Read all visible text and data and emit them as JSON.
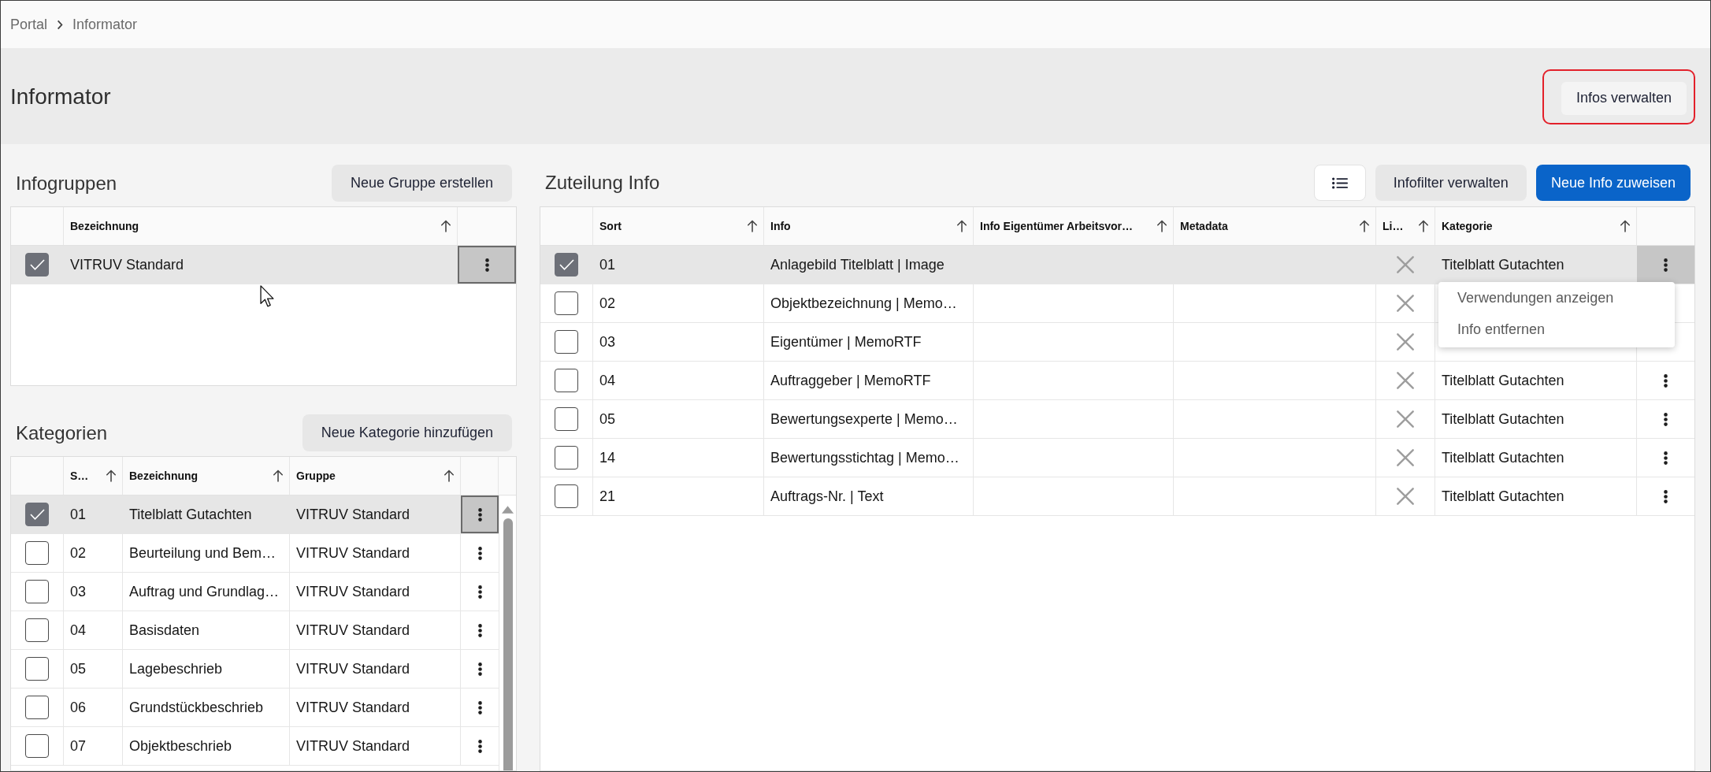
{
  "breadcrumb": [
    "Portal",
    "Informator"
  ],
  "header": {
    "title": "Informator",
    "button": {
      "label": "Infos verwalten",
      "highlighted": true
    }
  },
  "infogruppen": {
    "title": "Infogruppen",
    "button": "Neue Gruppe erstellen",
    "columns": [
      "Bezeichnung"
    ],
    "rows": [
      {
        "selected": true,
        "cells": [
          "VITRUV Standard"
        ]
      }
    ]
  },
  "kategorien": {
    "title": "Kategorien",
    "button": "Neue Kategorie hinzufügen",
    "columns": [
      "S…",
      "Bezeichnung",
      "Gruppe"
    ],
    "rows": [
      {
        "selected": true,
        "cells": [
          "01",
          "Titelblatt Gutachten",
          "VITRUV Standard"
        ]
      },
      {
        "selected": false,
        "cells": [
          "02",
          "Beurteilung und Bem…",
          "VITRUV Standard"
        ]
      },
      {
        "selected": false,
        "cells": [
          "03",
          "Auftrag und Grundlag…",
          "VITRUV Standard"
        ]
      },
      {
        "selected": false,
        "cells": [
          "04",
          "Basisdaten",
          "VITRUV Standard"
        ]
      },
      {
        "selected": false,
        "cells": [
          "05",
          "Lagebeschrieb",
          "VITRUV Standard"
        ]
      },
      {
        "selected": false,
        "cells": [
          "06",
          "Grundstückbeschrieb",
          "VITRUV Standard"
        ]
      },
      {
        "selected": false,
        "cells": [
          "07",
          "Objektbeschrieb",
          "VITRUV Standard"
        ]
      }
    ]
  },
  "zuteilung": {
    "title": "Zuteilung Info",
    "buttons": [
      {
        "kind": "icon"
      },
      {
        "kind": "secondary",
        "label": "Infofilter verwalten"
      },
      {
        "kind": "primary",
        "label": "Neue Info zuweisen"
      }
    ],
    "columns": [
      "Sort",
      "Info",
      "Info Eigentümer Arbeitsvor…",
      "Metadata",
      "Li…",
      "Kategorie"
    ],
    "rows": [
      {
        "selected": true,
        "sort": "01",
        "info": "Anlagebild Titelblatt | Image",
        "li": false,
        "kategorie": "Titelblatt Gutachten",
        "menu": [
          "Verwendungen anzeigen",
          "Info entfernen"
        ]
      },
      {
        "selected": false,
        "sort": "02",
        "info": "Objektbezeichnung | Memo…",
        "li": false
      },
      {
        "selected": false,
        "sort": "03",
        "info": "Eigentümer | MemoRTF",
        "li": false
      },
      {
        "selected": false,
        "sort": "04",
        "info": "Auftraggeber | MemoRTF",
        "li": false,
        "kategorie": "Titelblatt Gutachten"
      },
      {
        "selected": false,
        "sort": "05",
        "info": "Bewertungsexperte | Memo…",
        "li": false,
        "kategorie": "Titelblatt Gutachten"
      },
      {
        "selected": false,
        "sort": "14",
        "info": "Bewertungsstichtag | Memo…",
        "li": false,
        "kategorie": "Titelblatt Gutachten"
      },
      {
        "selected": false,
        "sort": "21",
        "info": "Auftrags-Nr. | Text",
        "li": false,
        "kategorie": "Titelblatt Gutachten"
      }
    ]
  }
}
